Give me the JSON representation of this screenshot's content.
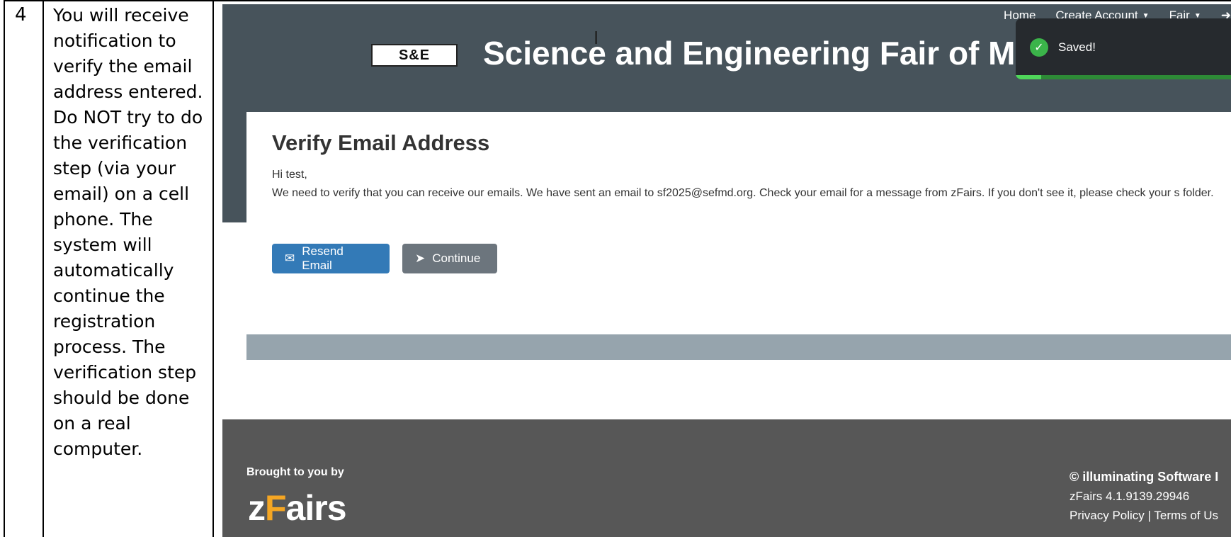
{
  "step": {
    "number": "4",
    "text": "You will receive\nnotification to\nverify the email\naddress entered.\nDo NOT try to do\nthe verification\nstep (via your\nemail) on a cell\nphone.  The\nsystem will\nautomatically\ncontinue the\nregistration\nprocess.  The\nverification step\nshould be done\non a real\ncomputer."
  },
  "nav": {
    "home": "Home",
    "create_account": "Create Account",
    "fair": "Fair"
  },
  "header": {
    "logo_text": "S&E",
    "title": "Science and Engineering Fair of Metro"
  },
  "toast": {
    "message": "Saved!",
    "progress_percent": 12
  },
  "panel": {
    "title": "Verify Email Address",
    "greeting": "Hi test,",
    "message": "We need to verify that you can receive our emails. We have sent an email to sf2025@sefmd.org. Check your email for a message from zFairs. If you don't see it, please check your s folder.",
    "resend_label": "Resend Email",
    "continue_label": "Continue"
  },
  "footer": {
    "brought_by": "Brought to you by",
    "logo_z": "z",
    "logo_f": "F",
    "logo_rest": "airs",
    "copyright": "© illuminating Software I",
    "version": "zFairs 4.1.9139.29946",
    "privacy": "Privacy Policy",
    "separator": " | ",
    "terms": "Terms of Us"
  },
  "colors": {
    "header_bg": "#47535b",
    "primary_button": "#337ab7",
    "secondary_button": "#6c757d",
    "footer_bg": "#575757",
    "toast_bg": "#262a2e",
    "accent_orange": "#f5a623"
  }
}
